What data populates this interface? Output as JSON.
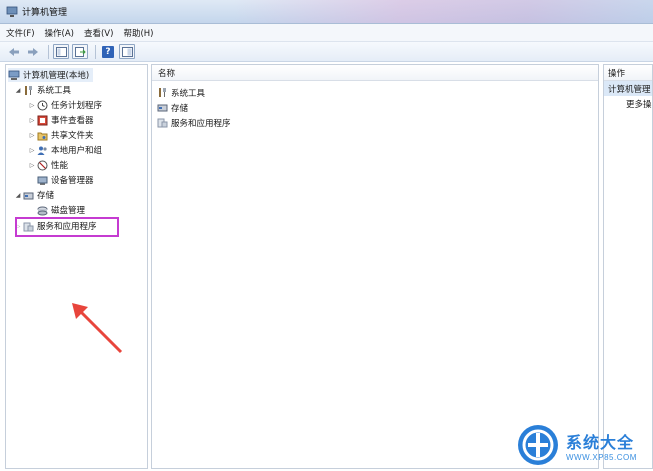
{
  "window": {
    "title": "计算机管理"
  },
  "menu": {
    "items": [
      "文件(F)",
      "操作(A)",
      "查看(V)",
      "帮助(H)"
    ]
  },
  "tree": {
    "root": "计算机管理(本地)",
    "system_tools": "系统工具",
    "task_scheduler": "任务计划程序",
    "event_viewer": "事件查看器",
    "shared_folders": "共享文件夹",
    "local_users": "本地用户和组",
    "performance": "性能",
    "device_manager": "设备管理器",
    "storage": "存储",
    "disk_management": "磁盘管理",
    "services_apps": "服务和应用程序"
  },
  "center": {
    "header": "名称",
    "items": [
      "系统工具",
      "存储",
      "服务和应用程序"
    ]
  },
  "actions": {
    "header": "操作",
    "selected": "计算机管理",
    "more": "更多操"
  },
  "watermark": {
    "title": "系统大全",
    "url": "WWW.XP85.COM"
  },
  "colors": {
    "highlight": "#c53bd1",
    "arrow": "#e8453c",
    "watermark": "#2a7fd8"
  }
}
